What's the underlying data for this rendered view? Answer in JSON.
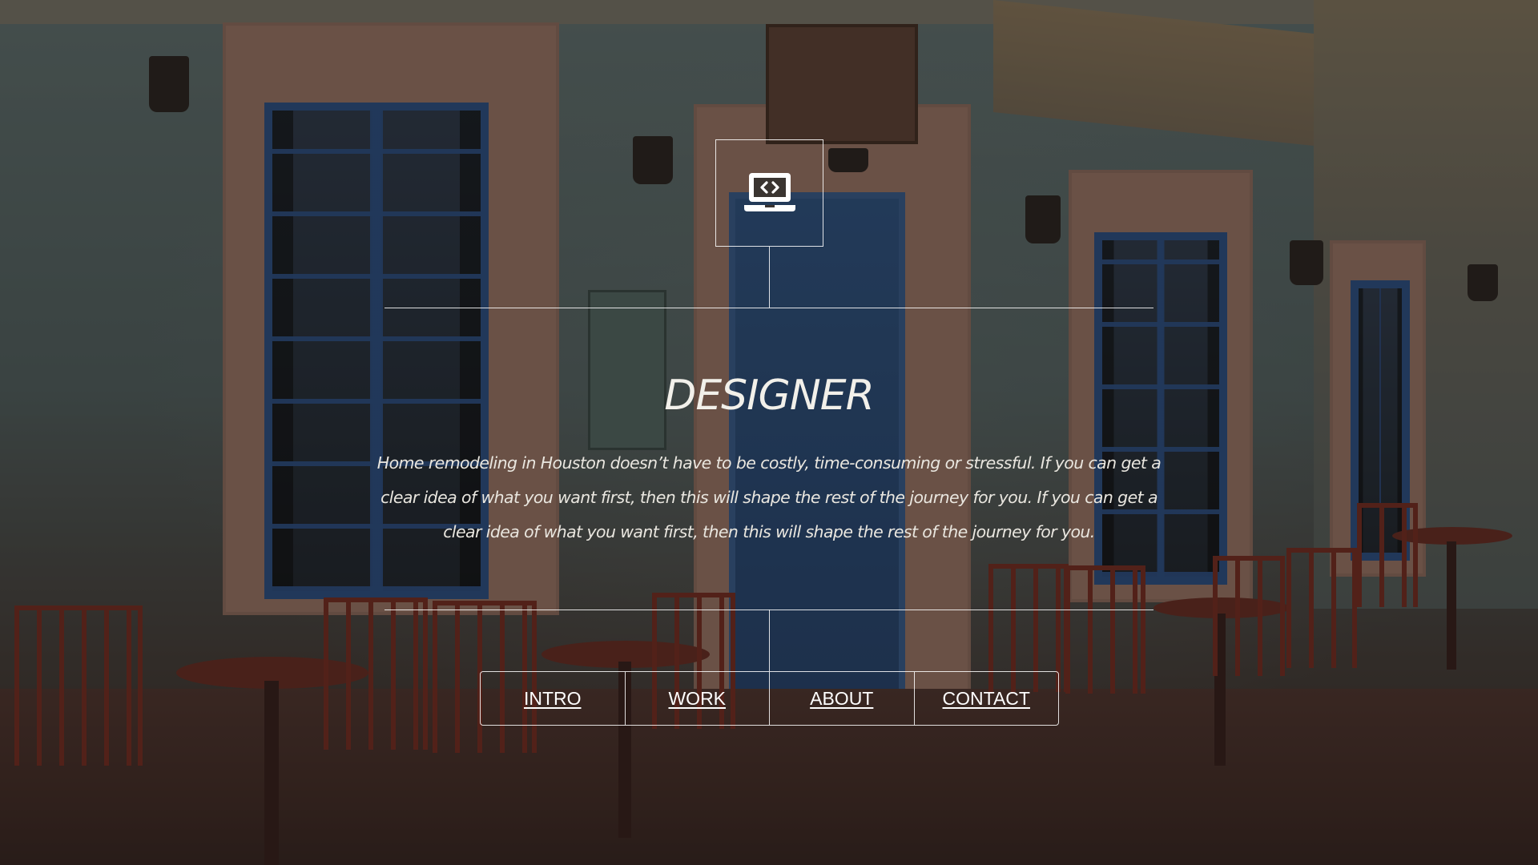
{
  "hero": {
    "icon": "laptop-code-icon",
    "title": "DESIGNER",
    "description": "Home remodeling in Houston doesn’t have to be costly, time-consuming or stressful. If you can get a clear idea of what you want first, then this will shape the rest of the journey for you. If you can get a clear idea of what you want first, then this will shape the rest of the journey for you."
  },
  "nav": {
    "items": [
      {
        "label": "INTRO"
      },
      {
        "label": "WORK"
      },
      {
        "label": "ABOUT"
      },
      {
        "label": "CONTACT"
      }
    ]
  },
  "colors": {
    "text": "#ffffff",
    "line": "#ffffff",
    "overlay": "#141210"
  }
}
